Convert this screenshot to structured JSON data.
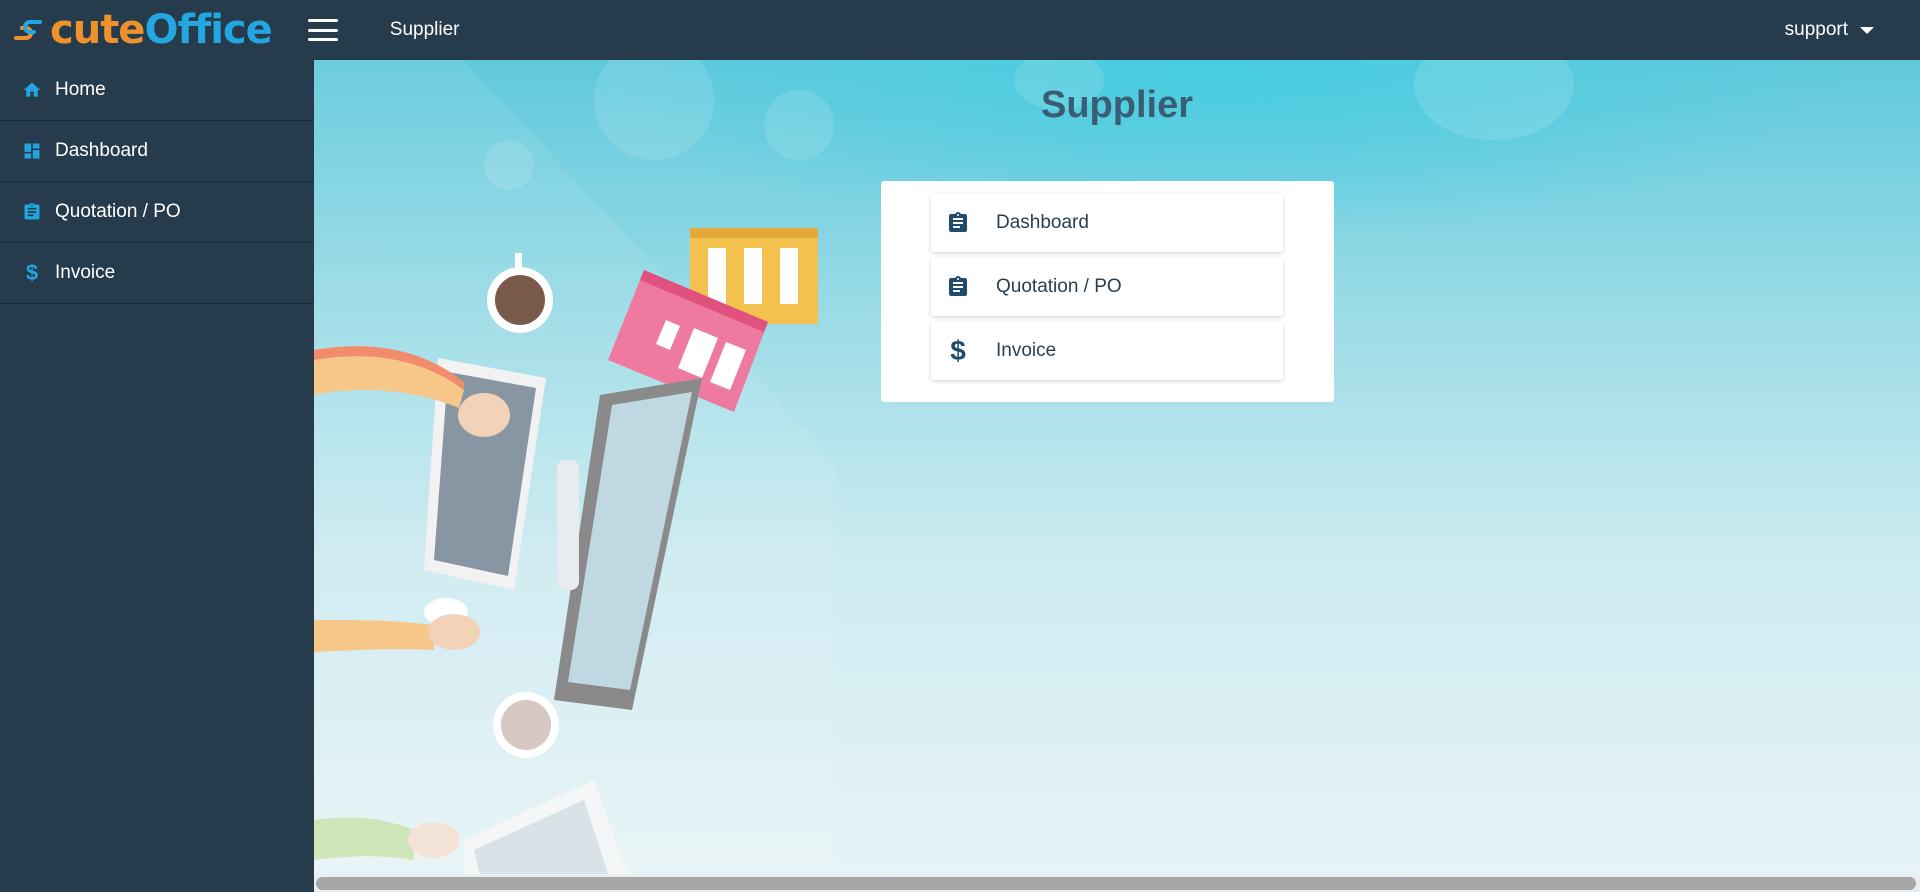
{
  "app": {
    "brand_cute": "cute",
    "brand_office": "Office",
    "section_title": "Supplier",
    "user": "support"
  },
  "sidebar": {
    "items": [
      {
        "label": "Home",
        "icon": "home-icon"
      },
      {
        "label": "Dashboard",
        "icon": "dashboard-icon"
      },
      {
        "label": "Quotation / PO",
        "icon": "clipboard-icon"
      },
      {
        "label": "Invoice",
        "icon": "dollar-icon"
      }
    ]
  },
  "main": {
    "title": "Supplier",
    "menu": [
      {
        "label": "Dashboard",
        "icon": "clipboard-icon"
      },
      {
        "label": "Quotation / PO",
        "icon": "clipboard-icon"
      },
      {
        "label": "Invoice",
        "icon": "dollar-icon"
      }
    ]
  },
  "icons": {
    "dollar_glyph": "$"
  },
  "colors": {
    "topbar_bg": "#263b4c",
    "accent_blue": "#23a3df",
    "brand_orange": "#f0922b",
    "card_icon": "#1f4b6e",
    "title_text": "#3a5d73"
  }
}
